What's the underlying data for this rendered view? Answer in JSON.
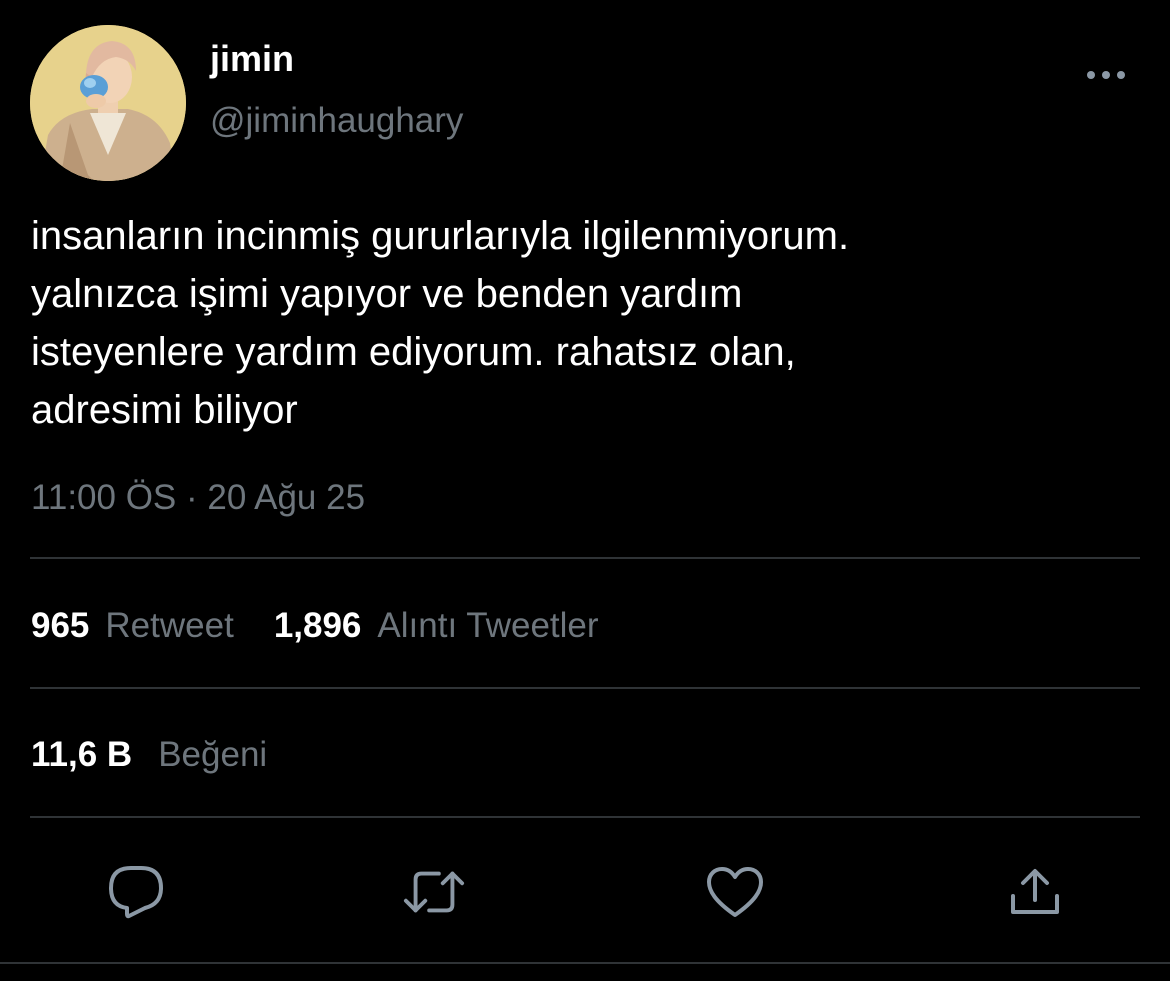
{
  "user": {
    "display_name": "jimin",
    "handle": "@jiminhaughary",
    "avatar_icon": "profile-photo"
  },
  "tweet": {
    "text": "insanların incinmiş gururlarıyla ilgilenmiyorum.\nyalnızca işimi yapıyor ve benden yardım\nisteyenlere yardım ediyorum. rahatsız olan,\nadresimi biliyor",
    "timestamp": "11:00 ÖS · 20 Ağu 25"
  },
  "stats": {
    "retweets_count": "965",
    "retweets_label": "Retweet",
    "quotes_count": "1,896",
    "quotes_label": "Alıntı Tweetler",
    "likes_count": "11,6 B",
    "likes_label": "Beğeni"
  },
  "actions": {
    "icons": [
      "reply-icon",
      "retweet-icon",
      "like-icon",
      "share-icon"
    ],
    "more_icon": "more-options-icon"
  },
  "colors": {
    "background": "#000000",
    "text_primary": "#ffffff",
    "text_secondary": "#6e767d",
    "divider": "#2f3336",
    "icon": "#8b98a5"
  }
}
